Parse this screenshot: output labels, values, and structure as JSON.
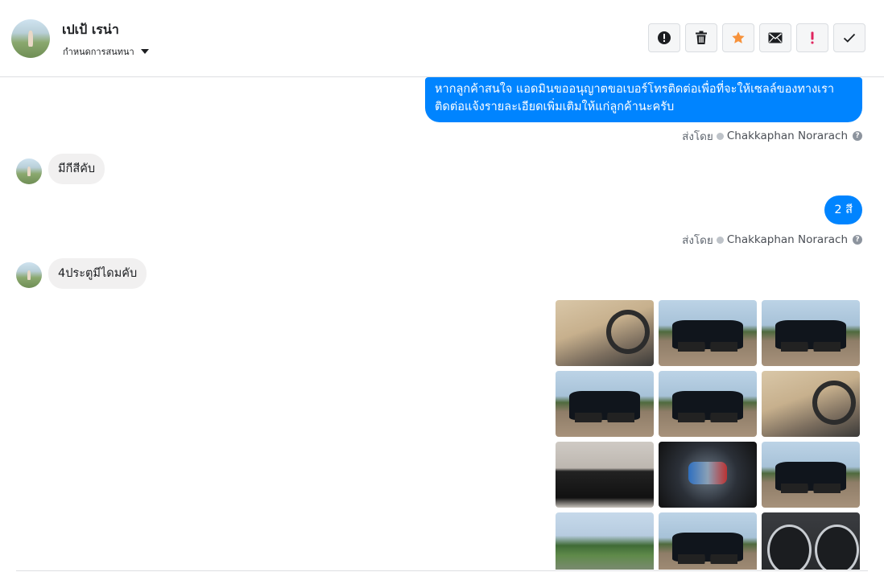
{
  "header": {
    "contact_name": "เปเป้ เรน่า",
    "assign_label": "กำหนดการสนทนา",
    "tools": [
      {
        "icon": "alert-circle-icon",
        "color": "#1c1e21"
      },
      {
        "icon": "trash-icon",
        "color": "#1c1e21"
      },
      {
        "icon": "star-icon",
        "color": "#f7923b"
      },
      {
        "icon": "envelope-icon",
        "color": "#1c1e21"
      },
      {
        "icon": "exclamation-icon",
        "color": "#e0245e"
      },
      {
        "icon": "check-icon",
        "color": "#1c1e21"
      }
    ]
  },
  "messages": {
    "m1_text": "หากลูกค้าสนใจ แอดมินขออนุญาตขอเบอร์โทรติดต่อเพื่อที่จะให้เซลล์ของทางเราติดต่อแจ้งรายละเอียดเพิ่มเติมให้แก่ลูกค้านะครับ",
    "m1_sent_label": "ส่งโดย",
    "m1_sender": "Chakkaphan Norarach",
    "m2_text": "มีกีสีคับ",
    "m3_text": "2 สี",
    "m3_sent_label": "ส่งโดย",
    "m3_sender": "Chakkaphan Norarach",
    "m4_text": "4ประตูมีไดมคับ"
  },
  "photos": [
    {
      "kind": "interior"
    },
    {
      "kind": "car"
    },
    {
      "kind": "car"
    },
    {
      "kind": "car"
    },
    {
      "kind": "car"
    },
    {
      "kind": "interior"
    },
    {
      "kind": "box"
    },
    {
      "kind": "engine"
    },
    {
      "kind": "car"
    },
    {
      "kind": "green"
    },
    {
      "kind": "car"
    },
    {
      "kind": "gauge"
    }
  ],
  "colors": {
    "outgoing_bubble": "#0084ff",
    "incoming_bubble": "#f1f0f0",
    "border": "#dddfe2"
  }
}
